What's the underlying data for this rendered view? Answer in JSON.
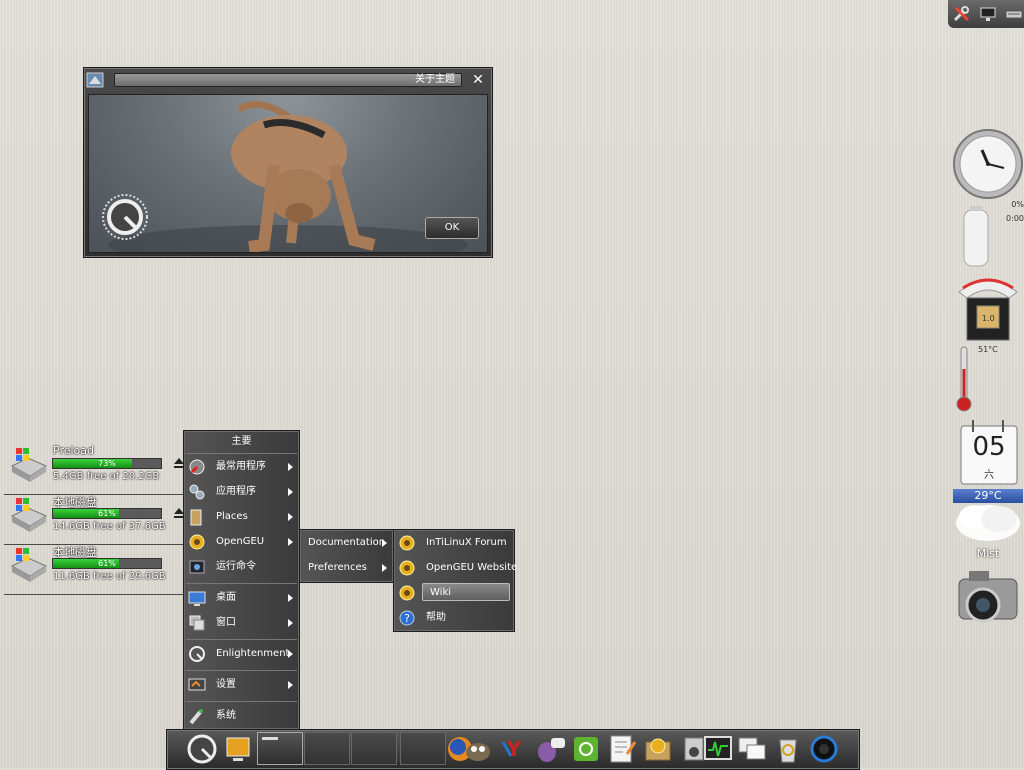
{
  "about_dialog": {
    "title": "关于主题",
    "ok_label": "OK",
    "close_icon": "close-icon"
  },
  "drives": [
    {
      "name": "Preload",
      "percent": 73,
      "percent_label": "73%",
      "free": "5.4GB free of 20.2GB"
    },
    {
      "name": "本地磁盘",
      "percent": 61,
      "percent_label": "61%",
      "free": "14.6GB free of 37.6GB"
    },
    {
      "name": "本地磁盘",
      "percent": 61,
      "percent_label": "61%",
      "free": "11.6GB free of 29.6GB"
    }
  ],
  "main_menu": {
    "title": "主要",
    "items": [
      {
        "label": "最常用程序",
        "icon": "favorites-icon"
      },
      {
        "label": "应用程序",
        "icon": "applications-icon"
      },
      {
        "label": "Places",
        "icon": "folder-icon"
      },
      {
        "label": "OpenGEU",
        "icon": "opengeu-icon"
      },
      {
        "label": "运行命令",
        "icon": "run-command-icon"
      },
      {
        "label": "桌面",
        "icon": "desktop-icon"
      },
      {
        "label": "窗口",
        "icon": "windows-icon"
      },
      {
        "label": "Enlightenment",
        "icon": "enlightenment-icon"
      },
      {
        "label": "设置",
        "icon": "settings-icon"
      },
      {
        "label": "系统",
        "icon": "system-icon"
      }
    ]
  },
  "opengeu_submenu": {
    "items": [
      {
        "label": "Documentation"
      },
      {
        "label": "Preferences"
      }
    ]
  },
  "documentation_submenu": {
    "items": [
      {
        "label": "InTiLinuX Forum",
        "icon": "opengeu-icon"
      },
      {
        "label": "OpenGEU Website",
        "icon": "opengeu-icon"
      },
      {
        "label": "Wiki",
        "icon": "opengeu-icon"
      },
      {
        "label": "帮助",
        "icon": "help-icon"
      }
    ]
  },
  "widgets": {
    "battery_label_1": "0%",
    "battery_label_2": "0:00",
    "cpu_label": "1.0",
    "cpu_temp": "51°C",
    "calendar_day": "05",
    "calendar_weekday": "六",
    "weather_temp": "29°C",
    "weather_label": "Mist"
  }
}
